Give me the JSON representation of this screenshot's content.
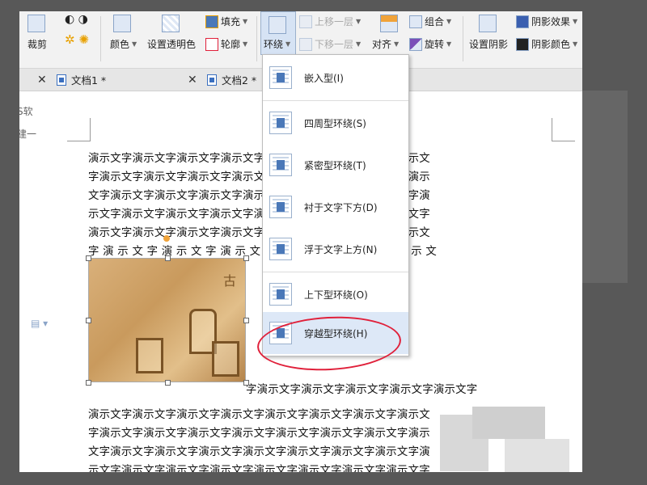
{
  "ribbon": {
    "crop": "裁剪",
    "color": "颜色",
    "set_transparent": "设置透明色",
    "fill": "填充",
    "outline": "轮廓",
    "wrap": "环绕",
    "bring_forward": "上移一层",
    "send_backward": "下移一层",
    "align": "对齐",
    "group": "组合",
    "rotate": "旋转",
    "shadow_settings": "设置阴影",
    "shadow_effect": "阴影效果",
    "shadow_color": "阴影颜色"
  },
  "tabs": [
    {
      "label": "文档1 *"
    },
    {
      "label": "文档2 *"
    }
  ],
  "sidebar": {
    "text1": "S软",
    "text2": "建一"
  },
  "document": {
    "lines_top": [
      "演示文字演示文字演示文字演示文字演示文字演示文字演示文字演示文",
      "字演示文字演示文字演示文字演示文字演示文字演示文字演示文字演示",
      "文字演示文字演示文字演示文字演示文字演示文字演示文字演示文字演",
      "示文字演示文字演示文字演示文字演示文字演示文字演示文字演示文字",
      "演示文字演示文字演示文字演示文字演示文字演示文字演示文字演示文",
      "字 演 示 文 字 演 示 文 字 演 示 文 字 演 示 文 字 演 示 文 字 演 示 文"
    ],
    "line_beside_image": "字演示文字演示文字演示文字演示文字演示文字",
    "lines_bottom": [
      "演示文字演示文字演示文字演示文字演示文字演示文字演示文字演示文",
      "字演示文字演示文字演示文字演示文字演示文字演示文字演示文字演示",
      "文字演示文字演示文字演示文字演示文字演示文字演示文字演示文字演",
      "示文字演示文字演示文字演示文字演示文字演示文字演示文字演示文字"
    ]
  },
  "wrap_menu": {
    "items": [
      {
        "label": "嵌入型(I)"
      },
      {
        "label": "四周型环绕(S)"
      },
      {
        "label": "紧密型环绕(T)"
      },
      {
        "label": "衬于文字下方(D)"
      },
      {
        "label": "浮于文字上方(N)"
      },
      {
        "label": "上下型环绕(O)"
      },
      {
        "label": "穿越型环绕(H)"
      }
    ],
    "selected_index": 6
  },
  "colors": {
    "accent": "#dde8f7",
    "highlight_circle": "#e0203a"
  }
}
